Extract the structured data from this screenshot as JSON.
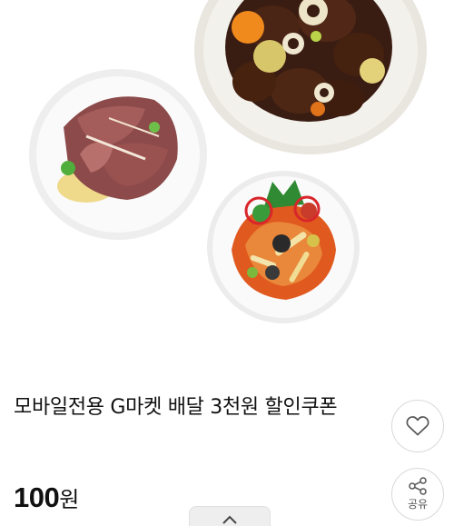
{
  "product": {
    "image_alt": "product-food-dishes-image",
    "title": "모바일전용 G마켓 배달 3천원 할인쿠폰",
    "price_value": "100",
    "price_unit": "원"
  },
  "actions": {
    "like_icon": "heart-outline-icon",
    "share_icon": "share-icon",
    "share_label": "공유",
    "scroll_top_icon": "chevron-up-icon"
  }
}
